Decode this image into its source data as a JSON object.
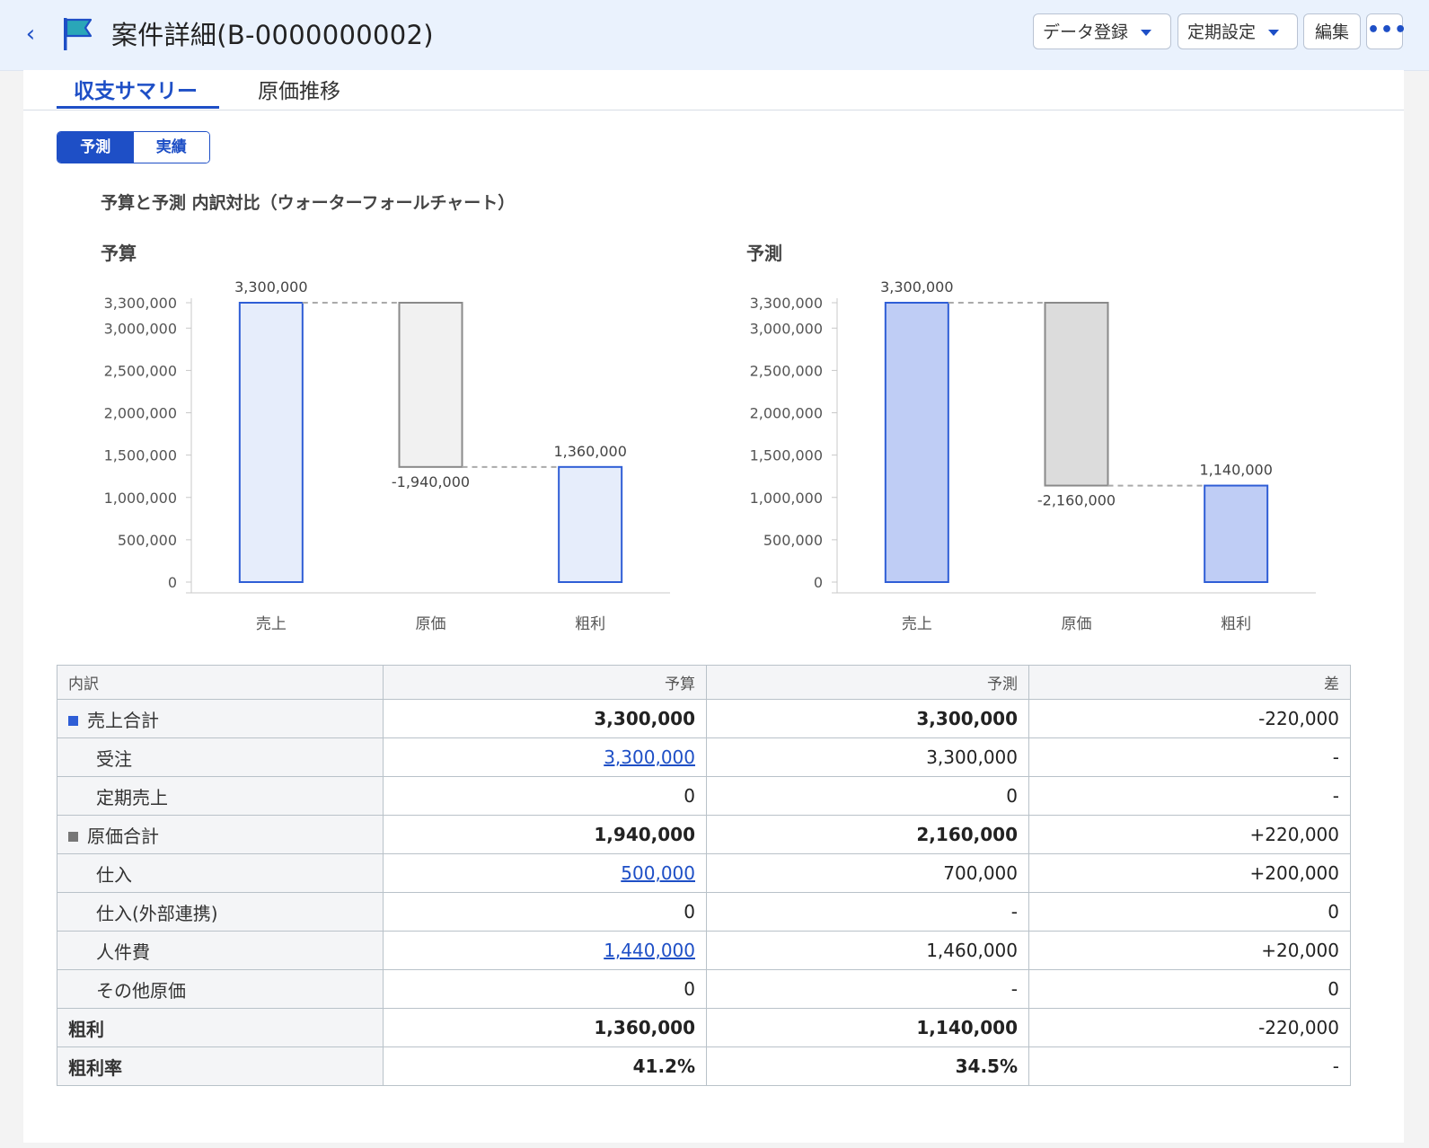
{
  "header": {
    "back_label": "‹",
    "title": "案件詳細(B-0000000002)",
    "buttons": {
      "data_register": "データ登録",
      "schedule": "定期設定",
      "edit": "編集",
      "more": "•••"
    },
    "colors": {
      "background": "#eaf2fd",
      "accent": "#1e4fc6",
      "flag": "#2aa6b8"
    }
  },
  "tabs": {
    "summary": "収支サマリー",
    "cost_trend": "原価推移"
  },
  "toggle": {
    "forecast": "予測",
    "actual": "実績"
  },
  "section_title": "予算と予測 内訳対比（ウォーターフォールチャート）",
  "charts": {
    "budget_label": "予算",
    "forecast_label": "予測"
  },
  "chart_data": [
    {
      "type": "bar",
      "subtype": "waterfall",
      "title": "予算",
      "categories": [
        "売上",
        "原価",
        "粗利"
      ],
      "values": [
        3300000,
        -1940000,
        1360000
      ],
      "data_labels": [
        "3,300,000",
        "-1,940,000",
        "1,360,000"
      ],
      "ylim": [
        0,
        3300000
      ],
      "yticks": [
        0,
        500000,
        1000000,
        1500000,
        2000000,
        2500000,
        3000000,
        3300000
      ],
      "ytick_labels": [
        "0",
        "500,000",
        "1,000,000",
        "1,500,000",
        "2,000,000",
        "2,500,000",
        "3,000,000",
        "3,300,000"
      ],
      "colors": {
        "positive_fill": "#e6edfb",
        "positive_stroke": "#2f5ed6",
        "negative_fill": "#f1f1f1",
        "negative_stroke": "#8a8a8a"
      }
    },
    {
      "type": "bar",
      "subtype": "waterfall",
      "title": "予測",
      "categories": [
        "売上",
        "原価",
        "粗利"
      ],
      "values": [
        3300000,
        -2160000,
        1140000
      ],
      "data_labels": [
        "3,300,000",
        "-2,160,000",
        "1,140,000"
      ],
      "ylim": [
        0,
        3300000
      ],
      "yticks": [
        0,
        500000,
        1000000,
        1500000,
        2000000,
        2500000,
        3000000,
        3300000
      ],
      "ytick_labels": [
        "0",
        "500,000",
        "1,000,000",
        "1,500,000",
        "2,000,000",
        "2,500,000",
        "3,000,000",
        "3,300,000"
      ],
      "colors": {
        "positive_fill": "#bfcdf5",
        "positive_stroke": "#2f5ed6",
        "negative_fill": "#dcdcdc",
        "negative_stroke": "#8a8a8a"
      }
    }
  ],
  "table": {
    "headers": [
      "内訳",
      "予算",
      "予測",
      "差"
    ],
    "legend_colors": {
      "sales": "#2f5ed6",
      "cost": "#777777"
    },
    "rows": [
      {
        "label": "売上合計",
        "budget": "3,300,000",
        "forecast": "3,300,000",
        "diff": "-220,000"
      },
      {
        "label": "受注",
        "budget": "3,300,000",
        "forecast": "3,300,000",
        "diff": "-"
      },
      {
        "label": "定期売上",
        "budget": "0",
        "forecast": "0",
        "diff": "-"
      },
      {
        "label": "原価合計",
        "budget": "1,940,000",
        "forecast": "2,160,000",
        "diff": "+220,000"
      },
      {
        "label": "仕入",
        "budget": "500,000",
        "forecast": "700,000",
        "diff": "+200,000"
      },
      {
        "label": "仕入(外部連携)",
        "budget": "0",
        "forecast": "-",
        "diff": "0"
      },
      {
        "label": "人件費",
        "budget": "1,440,000",
        "forecast": "1,460,000",
        "diff": "+20,000"
      },
      {
        "label": "その他原価",
        "budget": "0",
        "forecast": "-",
        "diff": "0"
      },
      {
        "label": "粗利",
        "budget": "1,360,000",
        "forecast": "1,140,000",
        "diff": "-220,000"
      },
      {
        "label": "粗利率",
        "budget": "41.2%",
        "forecast": "34.5%",
        "diff": "-"
      }
    ]
  }
}
